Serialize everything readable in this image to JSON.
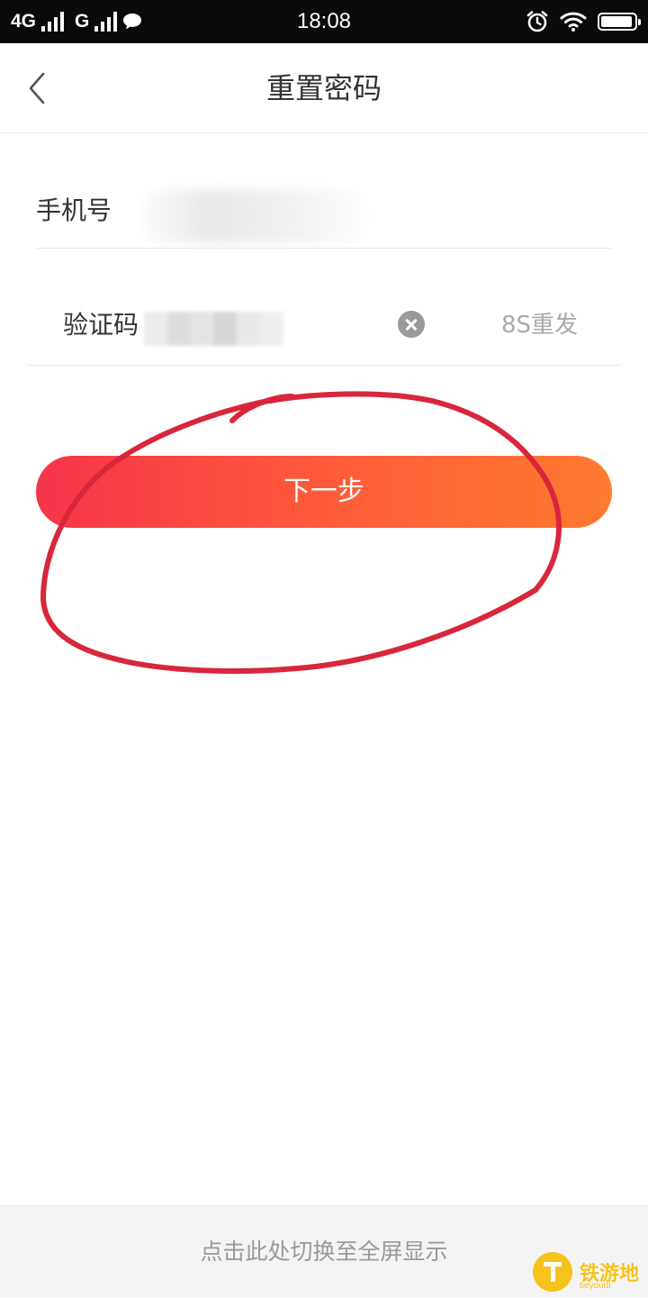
{
  "status_bar": {
    "network_1": "4G",
    "network_2": "G",
    "time": "18:08",
    "icons": [
      "signal-icon",
      "chat-bubble-icon",
      "alarm-icon",
      "wifi-icon",
      "battery-icon"
    ],
    "battery_level": 0.95
  },
  "nav": {
    "back_icon": "chevron-left-icon",
    "title": "重置密码"
  },
  "form": {
    "phone_label": "手机号",
    "code_label": "验证码",
    "clear_icon": "clear-circle-icon",
    "resend_label": "8S重发"
  },
  "next_button": {
    "label": "下一步"
  },
  "annotation": {
    "color": "#d8263a"
  },
  "bottom_bar": {
    "fullscreen_label": "点击此处切换至全屏显示"
  },
  "watermark": {
    "text": "铁游地",
    "sub": "tieyoudi",
    "color": "#f6c21c"
  },
  "colors": {
    "accent_start": "#f6354a",
    "accent_end": "#ff7a30",
    "status_bar": "#0a0a0a"
  }
}
